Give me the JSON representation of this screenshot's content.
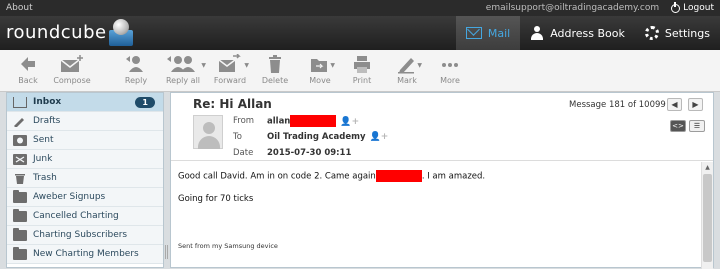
{
  "topbar": {
    "about": "About",
    "user": "emailsupport@oiltradingacademy.com",
    "logout": "Logout"
  },
  "header": {
    "logo": "roundcube"
  },
  "nav": [
    {
      "label": "Mail",
      "icon": "mail-icon"
    },
    {
      "label": "Address Book",
      "icon": "address-book-icon"
    },
    {
      "label": "Settings",
      "icon": "gear-icon"
    }
  ],
  "toolbar": {
    "back": "Back",
    "compose": "Compose",
    "reply": "Reply",
    "reply_all": "Reply all",
    "forward": "Forward",
    "delete": "Delete",
    "move": "Move",
    "print": "Print",
    "mark": "Mark",
    "more": "More"
  },
  "folders": [
    {
      "label": "Inbox",
      "badge": "1"
    },
    {
      "label": "Drafts"
    },
    {
      "label": "Sent"
    },
    {
      "label": "Junk"
    },
    {
      "label": "Trash"
    },
    {
      "label": "Aweber Signups"
    },
    {
      "label": "Cancelled Charting"
    },
    {
      "label": "Charting Subscribers"
    },
    {
      "label": "New Charting Members"
    }
  ],
  "message": {
    "subject": "Re: Hi Allan",
    "count": "Message 181 of 10099",
    "from_label": "From",
    "from_value": "allan",
    "to_label": "To",
    "to_value": "Oil Trading Academy",
    "date_label": "Date",
    "date_value": "2015-07-30 09:11",
    "body_line1_a": "Good call David.  Am in on code 2. Came again",
    "body_line1_b": ". I am amazed.",
    "body_line2": "Going for 70 ticks",
    "signature": "Sent from my Samsung device"
  },
  "colors": {
    "accent": "#45a7e0",
    "redaction": "#ff0000",
    "badge": "#1f4b69"
  }
}
